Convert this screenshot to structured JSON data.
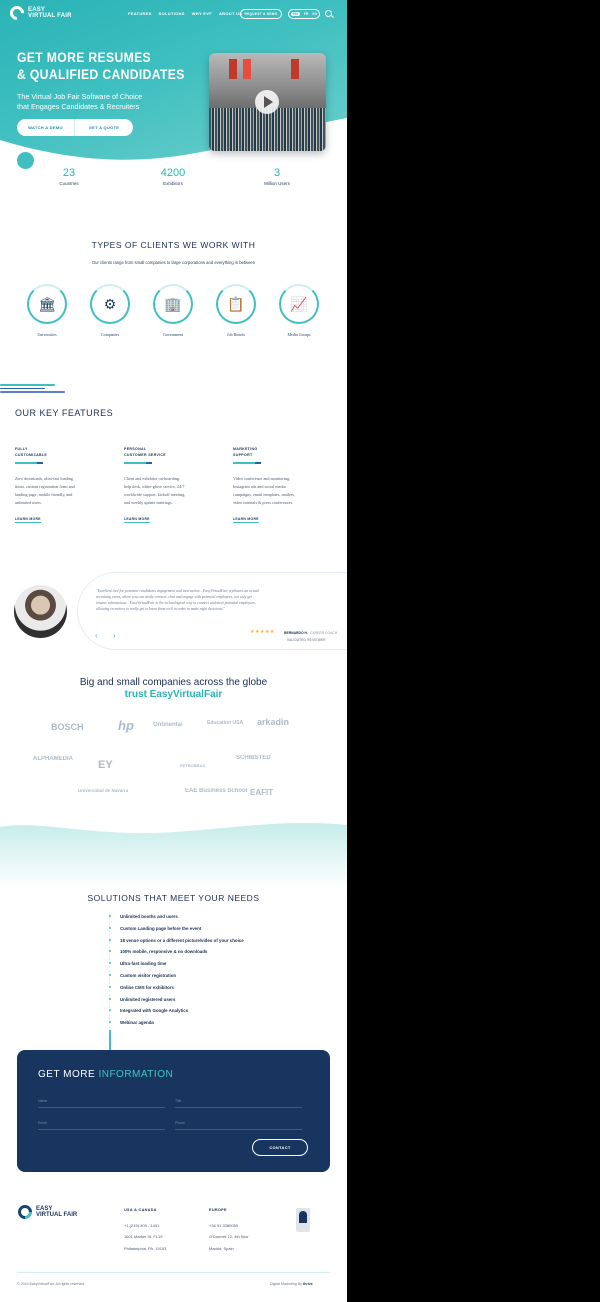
{
  "header": {
    "logo_line1": "EASY",
    "logo_line2": "VIRTUAL FAIR",
    "nav": [
      "FEATURES",
      "SOLUTIONS",
      "WHY EVF",
      "ABOUT US"
    ],
    "request_demo": "REQUEST A DEMO",
    "langs": [
      "EN",
      "FR",
      "ES"
    ]
  },
  "hero": {
    "title": "GET MORE RESUMES\n& QUALIFIED CANDIDATES",
    "subtitle": "The Virtual Job Fair Software of Choice\nthat Engages Candidates & Recruiters",
    "btn_demo": "WATCH A DEMO",
    "btn_quote": "GET A QUOTE"
  },
  "stats": [
    {
      "number": "23",
      "label": "Countries"
    },
    {
      "number": "4200",
      "label": "Exhibitors"
    },
    {
      "number": "3",
      "label": "Million Users"
    }
  ],
  "clients": {
    "title": "TYPES OF CLIENTS WE WORK WITH",
    "subtitle": "Our clients range from small companies to large corporations and everything in between",
    "items": [
      {
        "label": "Universities",
        "icon": "university-icon"
      },
      {
        "label": "Companies",
        "icon": "network-icon"
      },
      {
        "label": "Government",
        "icon": "capitol-icon"
      },
      {
        "label": "Job Boards",
        "icon": "job-board-icon"
      },
      {
        "label": "Media Groups",
        "icon": "laptop-chart-icon"
      }
    ]
  },
  "features": {
    "title": "OUR KEY FEATURES",
    "items": [
      {
        "title": "FULLY\nCUSTOMIZABLE",
        "desc": "Zero downloads, ultra-fast loading\ntimes, custom registration form and\nlanding page, mobile friendly, and\nunlimited users.",
        "link": "LEARN MORE"
      },
      {
        "title": "PERSONAL\nCUSTOMER SERVICE",
        "desc": "Client and exhibitor on-boarding,\nhelp desk, white-glove service, 24/7\nworldwide support, kickoff meeting,\nand weekly update meetings.",
        "link": "LEARN MORE"
      },
      {
        "title": "MARKETING\nSUPPORT",
        "desc": "Video conference and monitoring,\nInstagram ads and social media\ncampaigns, email templates, mailers,\nvideo tutorials & press conferences.",
        "link": "LEARN MORE"
      }
    ]
  },
  "testimonial": {
    "quote": "\"Excellent tool for potential candidates engagement and interaction... EasyVirtualFair replicates an actual\nrecruiting event, where you can easily connect, chat and engage with potential employees, not only get\nresume submissions... EasyVirtualFair is the technological way to connect and meet potential employees,\nallowing recruiters to really get to know them well in order to make right decisions.\"",
    "stars": "★★★★★",
    "reviewer": "BERNARDO H.",
    "role": "CAREER COACH",
    "verified": "VALIDATED REVIEWER"
  },
  "trust": {
    "line1": "Big and small companies across the globe",
    "line2": "trust EasyVirtualFair",
    "logos": [
      "BOSCH",
      "hp",
      "Ontinental",
      "Education USA",
      "arkadin",
      "ALPHAMEDIA",
      "EY",
      "PETROBRAS",
      "SCHIBSTED",
      "Universidad de Navarra",
      "EAE Business School",
      "EAFIT"
    ]
  },
  "solutions": {
    "title": "SOLUTIONS THAT MEET YOUR NEEDS",
    "items": [
      "Unlimited booths and users",
      "Custom Landing page before the event",
      "18 venue options or a different picture/video of your choice",
      "100% mobile, responsive & no downloads",
      "Ultra-fast loading time",
      "Custom visitor registration",
      "Online CMS for exhibitors",
      "Unlimited registered users",
      "Integrated with Google Analytics",
      "Webinar agenda"
    ]
  },
  "form": {
    "title_a": "GET MORE ",
    "title_b": "INFORMATION",
    "fields": [
      "Name",
      "Title",
      "Email",
      "Phone"
    ],
    "button": "CONTACT"
  },
  "footer": {
    "logo_line1": "EASY",
    "logo_line2": "VIRTUAL FAIR",
    "usa": {
      "head": "USA & CANADA",
      "lines": [
        "+1 (215) 309 - 1441",
        "1601 Market St. FL19",
        "Philadelphia, PA. 19103"
      ]
    },
    "europe": {
      "head": "EUROPE",
      "lines": [
        "+34 91 3380059",
        "O'Donnell 12, 4th floor",
        "Madrid, Spain"
      ]
    },
    "copyright": "© 2019 EasyVirtualFair. All rights reserved.",
    "digital": "Digital Marketing By",
    "digital_brand": "thrive"
  },
  "colors": {
    "teal": "#3fbfc0",
    "navy": "#17355f"
  }
}
